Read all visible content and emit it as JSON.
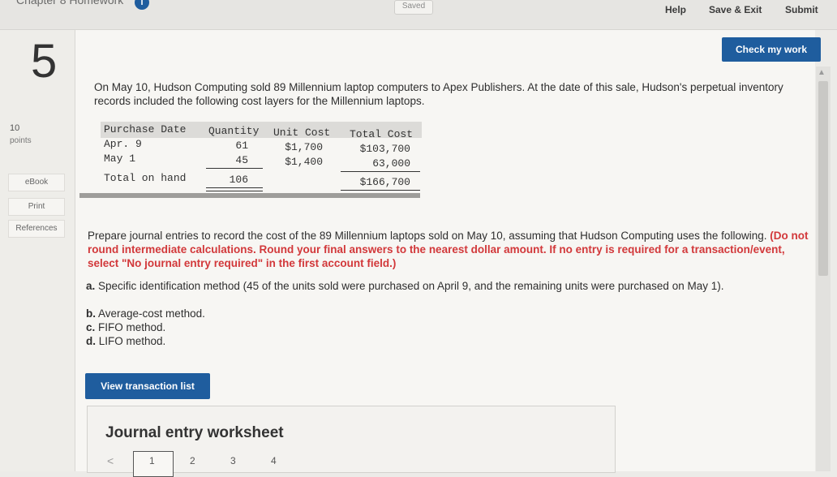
{
  "header": {
    "chapter": "Chapter 8 Homework",
    "badge": "i",
    "saved": "Saved",
    "help": "Help",
    "save_exit": "Save & Exit",
    "submit": "Submit",
    "check_my_work": "Check my work"
  },
  "sidebar": {
    "question_number": "5",
    "points_value": "10",
    "points_label": "points",
    "ebook": "eBook",
    "print": "Print",
    "references": "References"
  },
  "question": {
    "intro": "On May 10, Hudson Computing sold 89 Millennium laptop computers to Apex Publishers. At the date of this sale, Hudson's perpetual inventory records included the following cost layers for the Millennium laptops.",
    "prompt": "Prepare journal entries to record the cost of the 89 Millennium laptops sold on May 10, assuming that Hudson Computing uses the following.",
    "instruction": "(Do not round intermediate calculations. Round your final answers to the nearest dollar amount. If no entry is required for a transaction/event, select \"No journal entry required\" in the first account field.)",
    "options": {
      "a_letter": "a.",
      "a_text": "Specific identification method (45 of the units sold were purchased on April 9, and the remaining units were purchased on May 1).",
      "b_letter": "b.",
      "b_text": "Average-cost method.",
      "c_letter": "c.",
      "c_text": "FIFO method.",
      "d_letter": "d.",
      "d_text": "LIFO method."
    }
  },
  "inventory": {
    "headers": {
      "date": "Purchase Date",
      "qty": "Quantity",
      "unit": "Unit Cost",
      "total": "Total Cost"
    },
    "rows": [
      {
        "date": "Apr. 9",
        "qty": "61",
        "unit": "$1,700",
        "total": "$103,700"
      },
      {
        "date": "May 1",
        "qty": "45",
        "unit": "$1,400",
        "total": "63,000"
      }
    ],
    "total_row": {
      "label": "Total on hand",
      "qty": "106",
      "total": "$166,700"
    }
  },
  "buttons": {
    "view_transaction_list": "View transaction list"
  },
  "journal": {
    "title": "Journal entry worksheet",
    "prev": "<",
    "pages": [
      "1",
      "2",
      "3",
      "4"
    ]
  }
}
